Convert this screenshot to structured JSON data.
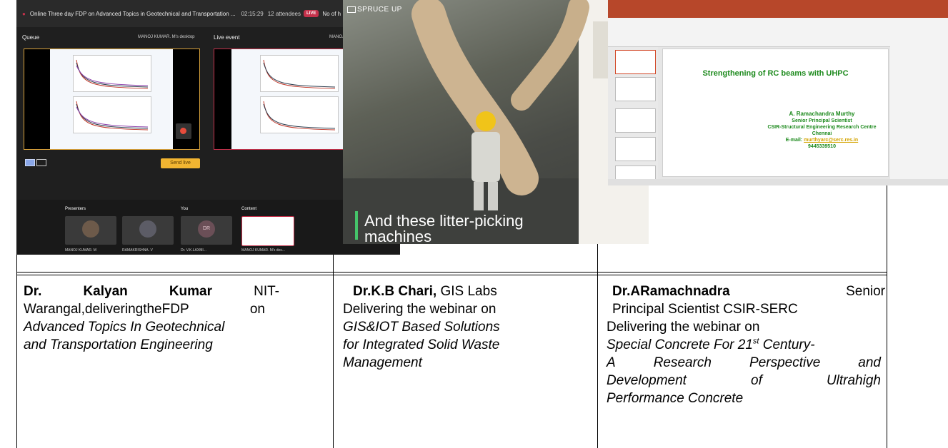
{
  "teams": {
    "meeting_title": "Online Three day FDP on Advanced Topics in Geotechnical and Transportation ...",
    "elapsed": "02:15:29",
    "attendees": "12 attendees",
    "live_badge": "LIVE",
    "topbar_tail": "No of h",
    "queue_label": "Queue",
    "queue_source": "MANOJ KUMAR. M's desktop",
    "live_event_label": "Live event",
    "live_source": "MANOJ KU",
    "send_live": "Send live",
    "presenters_label": "Presenters",
    "you_label": "You",
    "content_label": "Content",
    "avatar_initials": "DR",
    "participants": [
      "MANOJ KUMAR. M",
      "RAMAKRISHNA. V",
      "Dr. V.K.LAXMI...",
      "MANOJ KUMAR. M's des..."
    ]
  },
  "video": {
    "brand": "SPRUCE UP",
    "caption_line1": "And these litter-picking",
    "caption_line2": "machines"
  },
  "ppt": {
    "slide_title": "Strengthening of RC beams with UHPC",
    "presenter": "A.   Ramachandra Murthy",
    "designation": "Senior Principal Scientist",
    "organization": "CSIR-Structural Engineering Research Centre",
    "city": "Chennai",
    "email_label": "E-mail:",
    "email": "murthyarc@serc.res.in",
    "phone": "9445339510"
  },
  "captions": [
    {
      "name_bold": "Dr.",
      "name_bold_2": "Kalyan",
      "name_bold_3": "Kumar",
      "affil_1": "NIT-",
      "affil_2a": "Warangal,deliveringtheFDP",
      "affil_2b": "on",
      "topic_1": "Advanced Topics In Geotechnical",
      "topic_2": "and Transportation Engineering"
    },
    {
      "name_bold": "Dr.K.B Chari,",
      "affil": " GIS Labs",
      "line_2": "Delivering the webinar on",
      "topic_1": "GIS&IOT Based Solutions",
      "topic_2": "for Integrated Solid Waste",
      "topic_3": "Management"
    },
    {
      "name_bold": "Dr.ARamachnadra",
      "title_1": "Senior",
      "line_2": "Principal Scientist CSIR-SERC",
      "line_3": "Delivering the webinar on",
      "topic_1a": "Special Concrete For 21",
      "topic_1sup": "st",
      "topic_1b": " Century-",
      "topic_2a": "A",
      "topic_2b": "Research",
      "topic_2c": "Perspective",
      "topic_2d": "and",
      "topic_3a": "Development",
      "topic_3b": "of",
      "topic_3c": "Ultrahigh",
      "topic_4": "Performance Concrete"
    }
  ]
}
